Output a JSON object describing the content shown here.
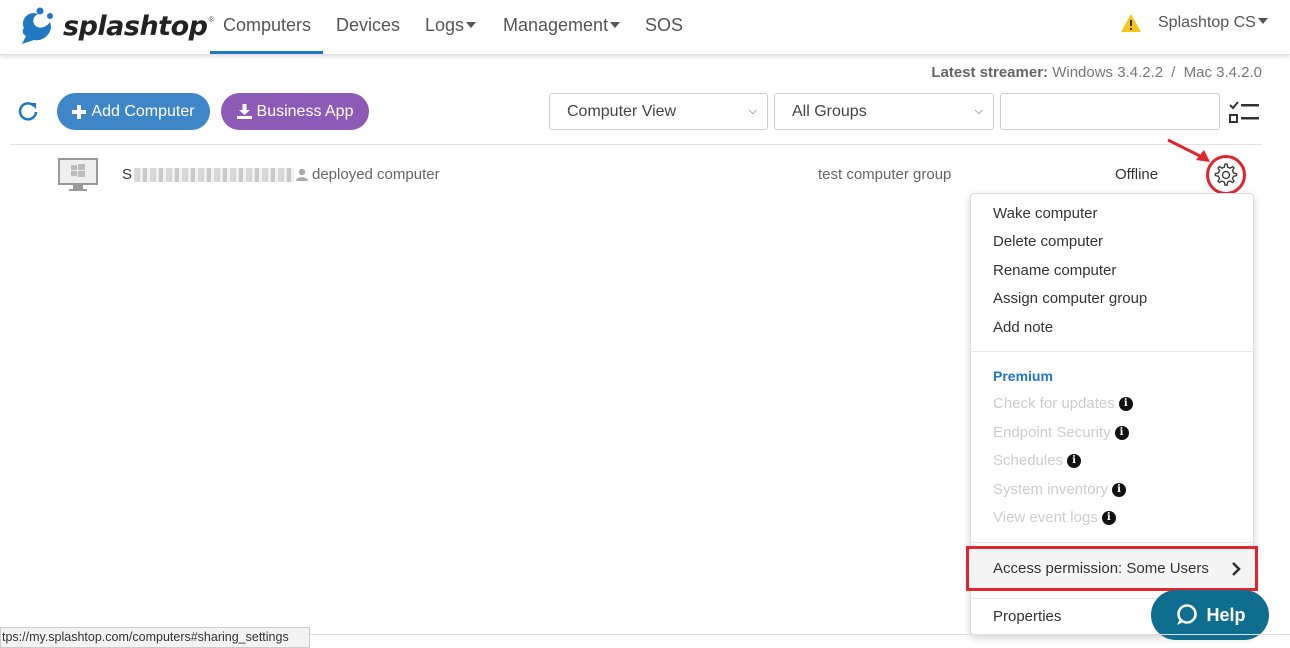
{
  "brand": {
    "name": "splashtop",
    "trademark": "®"
  },
  "nav": {
    "items": [
      {
        "label": "Computers",
        "dropdown": false
      },
      {
        "label": "Devices",
        "dropdown": false
      },
      {
        "label": "Logs",
        "dropdown": true
      },
      {
        "label": "Management",
        "dropdown": true
      },
      {
        "label": "SOS",
        "dropdown": false
      }
    ],
    "active": "Computers",
    "account_label": "Splashtop CS",
    "warning_icon": "warning-triangle-icon"
  },
  "streamer": {
    "label": "Latest streamer:",
    "windows": "Windows 3.4.2.2",
    "separator": "/",
    "mac": "Mac 3.4.2.0"
  },
  "toolbar": {
    "add_computer": "Add Computer",
    "business_app": "Business App",
    "view_select": {
      "value": "Computer View"
    },
    "group_select": {
      "value": "All Groups"
    },
    "search": {
      "value": ""
    }
  },
  "computer": {
    "name_prefix": "S",
    "deployed_label": "deployed computer",
    "group": "test computer group",
    "status": "Offline"
  },
  "menu": {
    "items": [
      "Wake computer",
      "Delete computer",
      "Rename computer",
      "Assign computer group",
      "Add note"
    ],
    "premium_header": "Premium",
    "premium_items": [
      "Check for updates",
      "Endpoint Security",
      "Schedules",
      "System inventory",
      "View event logs"
    ],
    "access_permission": "Access permission: Some Users",
    "properties": "Properties"
  },
  "help": {
    "label": "Help"
  },
  "status_url": "tps://my.splashtop.com/computers#sharing_settings",
  "colors": {
    "primary_blue": "#3f86c9",
    "purple": "#8d5bb5",
    "highlight_red": "#e0262c",
    "help_teal": "#0f6e8f",
    "premium_blue": "#1f78c1"
  }
}
